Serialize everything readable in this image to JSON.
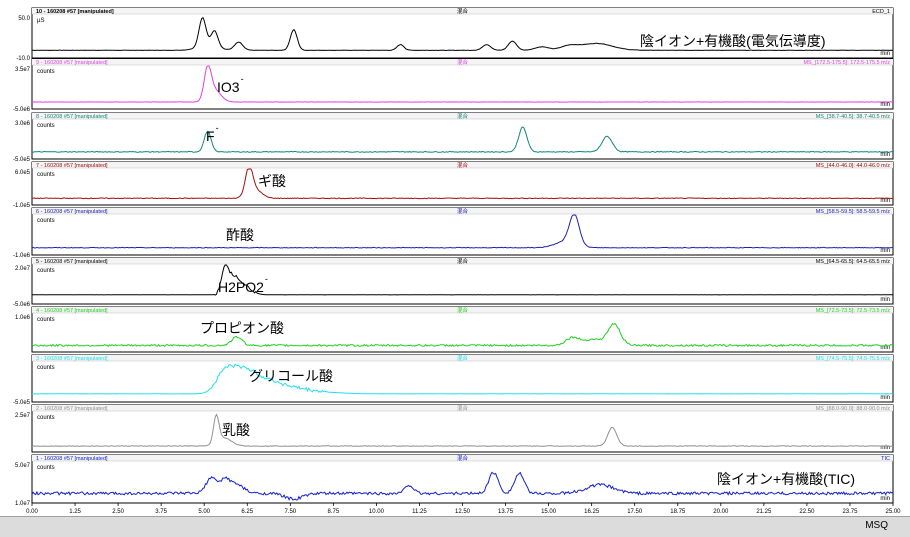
{
  "status": {
    "mode": "MSQ"
  },
  "chart_data": {
    "type": "line",
    "xlim": [
      0.0,
      25.0
    ],
    "x_ticks": [
      "0.00",
      "1.25",
      "2.50",
      "3.75",
      "5.00",
      "6.25",
      "7.50",
      "8.75",
      "10.00",
      "11.25",
      "12.50",
      "13.75",
      "15.00",
      "16.25",
      "17.50",
      "18.75",
      "20.00",
      "21.25",
      "22.50",
      "23.75",
      "25.00"
    ],
    "x_unit": "min",
    "panels": [
      {
        "header": "10 - 160208 #57 [manipulated]",
        "header_center": "混合",
        "header_right": "ECD_1",
        "units": "µS",
        "y_top": "50.0",
        "y_bottom": "-10.0",
        "ylim": [
          -10,
          60
        ],
        "label": "陰イオン+有機酸(電気伝導度)",
        "color": "#000000",
        "baseline": 0,
        "peaks": [
          [
            4.95,
            50,
            0.1
          ],
          [
            5.3,
            28,
            0.1
          ],
          [
            5.1,
            8,
            0.3
          ],
          [
            6.0,
            14,
            0.12
          ],
          [
            7.6,
            36,
            0.1
          ],
          [
            10.7,
            10,
            0.1
          ],
          [
            13.2,
            10,
            0.12
          ],
          [
            13.95,
            16,
            0.12
          ],
          [
            14.8,
            6,
            0.2
          ],
          [
            15.6,
            7,
            0.25
          ],
          [
            16.4,
            12,
            0.45
          ]
        ],
        "noise": 0.3
      },
      {
        "header": "9 - 160208 #57 [manipulated]",
        "header_center": "混合",
        "header_right": "MS_[172.5-175.5]: 172.5-175.5 m/z",
        "units": "counts",
        "y_top": "3.5e7",
        "y_bottom": "-5.0e6",
        "ylim": [
          -5000000,
          35000000
        ],
        "label": "IO3",
        "label_sup": "-",
        "color": "#e040e0",
        "baseline": 0,
        "peaks": [
          [
            5.1,
            31000000,
            0.1
          ],
          [
            5.3,
            12000000,
            0.18
          ]
        ],
        "noise": 100000
      },
      {
        "header": "8 - 160208 #57 [manipulated]",
        "header_center": "混合",
        "header_right": "MS_[38.7-40.5]: 38.7-40.5 m/z",
        "units": "counts",
        "y_top": "3.0e6",
        "y_bottom": "-5.0e5",
        "ylim": [
          -500000,
          3000000
        ],
        "label": "F",
        "label_sup": "-",
        "color": "#108878",
        "baseline": 0,
        "peaks": [
          [
            5.1,
            2000000,
            0.1
          ],
          [
            14.25,
            2400000,
            0.12
          ],
          [
            16.7,
            1500000,
            0.15
          ]
        ],
        "noise": 40000
      },
      {
        "header": "7 - 160208 #57 [manipulated]",
        "header_center": "混合",
        "header_right": "MS_[44.0-46.0]: 44.0-46.0 m/z",
        "units": "counts",
        "y_top": "6.0e5",
        "y_bottom": "-1.0e5",
        "ylim": [
          -100000,
          600000
        ],
        "label": "ギ酸",
        "color": "#a01010",
        "baseline": 0,
        "peaks": [
          [
            6.3,
            560000,
            0.1
          ],
          [
            6.45,
            200000,
            0.2
          ]
        ],
        "noise": 8000
      },
      {
        "header": "6 - 160208 #57 [manipulated]",
        "header_center": "混合",
        "header_right": "MS_[58.5-59.5]: 58.5-59.5 m/z",
        "units": "counts",
        "y_top": "",
        "y_bottom": "-1.0e6",
        "ylim": [
          -1000000,
          6000000
        ],
        "label": "酢酸",
        "color": "#2020b0",
        "baseline": 0,
        "peaks": [
          [
            15.75,
            5600000,
            0.14
          ],
          [
            15.5,
            1200000,
            0.3
          ]
        ],
        "noise": 60000
      },
      {
        "header": "5 - 160208 #57 [manipulated]",
        "header_center": "混合",
        "header_right": "MS_[64.5-65.5]: 64.5-65.5 m/z",
        "units": "counts",
        "y_top": "2.0e7",
        "y_bottom": "-5.0e6",
        "ylim": [
          -5000000,
          20000000
        ],
        "label": "H2PO2",
        "label_sup": "-",
        "color": "#000000",
        "baseline": 0,
        "peaks": [
          [
            5.6,
            17000000,
            0.1
          ],
          [
            5.85,
            12000000,
            0.18
          ],
          [
            6.2,
            5000000,
            0.2
          ]
        ],
        "noise": 900000,
        "noise_range": [
          5.3,
          6.5
        ]
      },
      {
        "header": "4 - 160208 #57 [manipulated]",
        "header_center": "混合",
        "header_right": "MS_[72.5-73.5]: 72.5-73.5 m/z",
        "units": "counts",
        "y_top": "1.0e6",
        "y_bottom": "",
        "ylim": [
          -150000,
          1000000
        ],
        "label": "プロピオン酸",
        "color": "#20d020",
        "baseline": 0,
        "peaks": [
          [
            5.95,
            280000,
            0.15
          ],
          [
            16.9,
            700000,
            0.18
          ],
          [
            16.3,
            200000,
            0.25
          ],
          [
            15.7,
            260000,
            0.2
          ]
        ],
        "noise": 30000
      },
      {
        "header": "3 - 160208 #57 [manipulated]",
        "header_center": "混合",
        "header_right": "MS_[74.5-75.5]: 74.5-75.5 m/z",
        "units": "counts",
        "y_top": "",
        "y_bottom": "-5.0e5",
        "ylim": [
          -500000,
          2500000
        ],
        "label": "グリコール酸",
        "color": "#20e0f0",
        "baseline": 0,
        "peaks": [
          [
            5.6,
            1700000,
            0.25
          ],
          [
            6.1,
            1500000,
            0.3
          ],
          [
            6.6,
            900000,
            0.4
          ],
          [
            7.2,
            500000,
            0.5
          ],
          [
            8.0,
            200000,
            0.7
          ]
        ],
        "noise": 150000,
        "noise_range": [
          5.2,
          8.5
        ]
      },
      {
        "header": "2 - 160208 #57 [manipulated]",
        "header_center": "混合",
        "header_right": "MS_[88.0-90.0]: 88.0-90.0 m/z",
        "units": "counts",
        "y_top": "2.5e7",
        "y_bottom": "",
        "ylim": [
          -3000000,
          25000000
        ],
        "label": "乳酸",
        "color": "#909090",
        "baseline": 0,
        "peaks": [
          [
            5.35,
            21000000,
            0.08
          ],
          [
            5.6,
            6000000,
            0.2
          ],
          [
            16.85,
            14000000,
            0.13
          ]
        ],
        "noise": 250000
      },
      {
        "header": "1 - 160208 #57 [manipulated]",
        "header_center": "混合",
        "header_right": "TIC",
        "units": "counts",
        "y_top": "5.0e7",
        "y_bottom": "1.0e7",
        "ylim": [
          10000000,
          50000000
        ],
        "label": "陰イオン+有機酸(TIC)",
        "color": "#1020d0",
        "baseline": 18000000,
        "peaks": [
          [
            5.2,
            16000000,
            0.15
          ],
          [
            5.6,
            14000000,
            0.15
          ],
          [
            5.95,
            9000000,
            0.2
          ],
          [
            7.6,
            -6000000,
            0.25
          ],
          [
            10.95,
            9000000,
            0.12
          ],
          [
            13.4,
            22000000,
            0.14
          ],
          [
            14.15,
            21000000,
            0.14
          ],
          [
            16.5,
            9000000,
            0.4
          ]
        ],
        "noise": 1500000
      }
    ]
  }
}
